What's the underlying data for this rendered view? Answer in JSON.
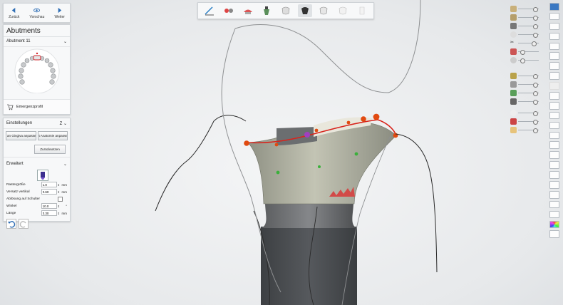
{
  "nav": {
    "back_label": "Zurück",
    "preview_label": "Vorschau",
    "next_label": "Weiter"
  },
  "abutments": {
    "title": "Abutments",
    "selected": "Abutment 11",
    "emergence_label": "Emergenzprofil"
  },
  "settings": {
    "title": "Einstellungen",
    "axis_value": "Z",
    "btn_gingiva": "an Gingiva anpassen",
    "btn_anatomy": "t Anatomie anpassen",
    "btn_reset": "Zurücksetzen",
    "advanced_label": "Erweitert",
    "grid_label": "Rastergröße",
    "grid_value": "1.0",
    "grid_unit": "mm",
    "offset_label": "Versatz vertikal",
    "offset_value": "0.60",
    "offset_unit": "mm",
    "shoulder_label": "Ablösung auf Schulter",
    "angle_label": "Winkel",
    "angle_value": "10.0",
    "angle_unit": "°",
    "length_label": "Länge",
    "length_value": "0.30",
    "length_unit": "mm"
  },
  "colors": {
    "abutment_body": "#a9aa9c",
    "implant_post": "#4a4d51",
    "margin_line": "#d8241c",
    "control_point": "#e14a10",
    "green_point": "#3bb03b",
    "purple_point": "#a13fc0"
  }
}
